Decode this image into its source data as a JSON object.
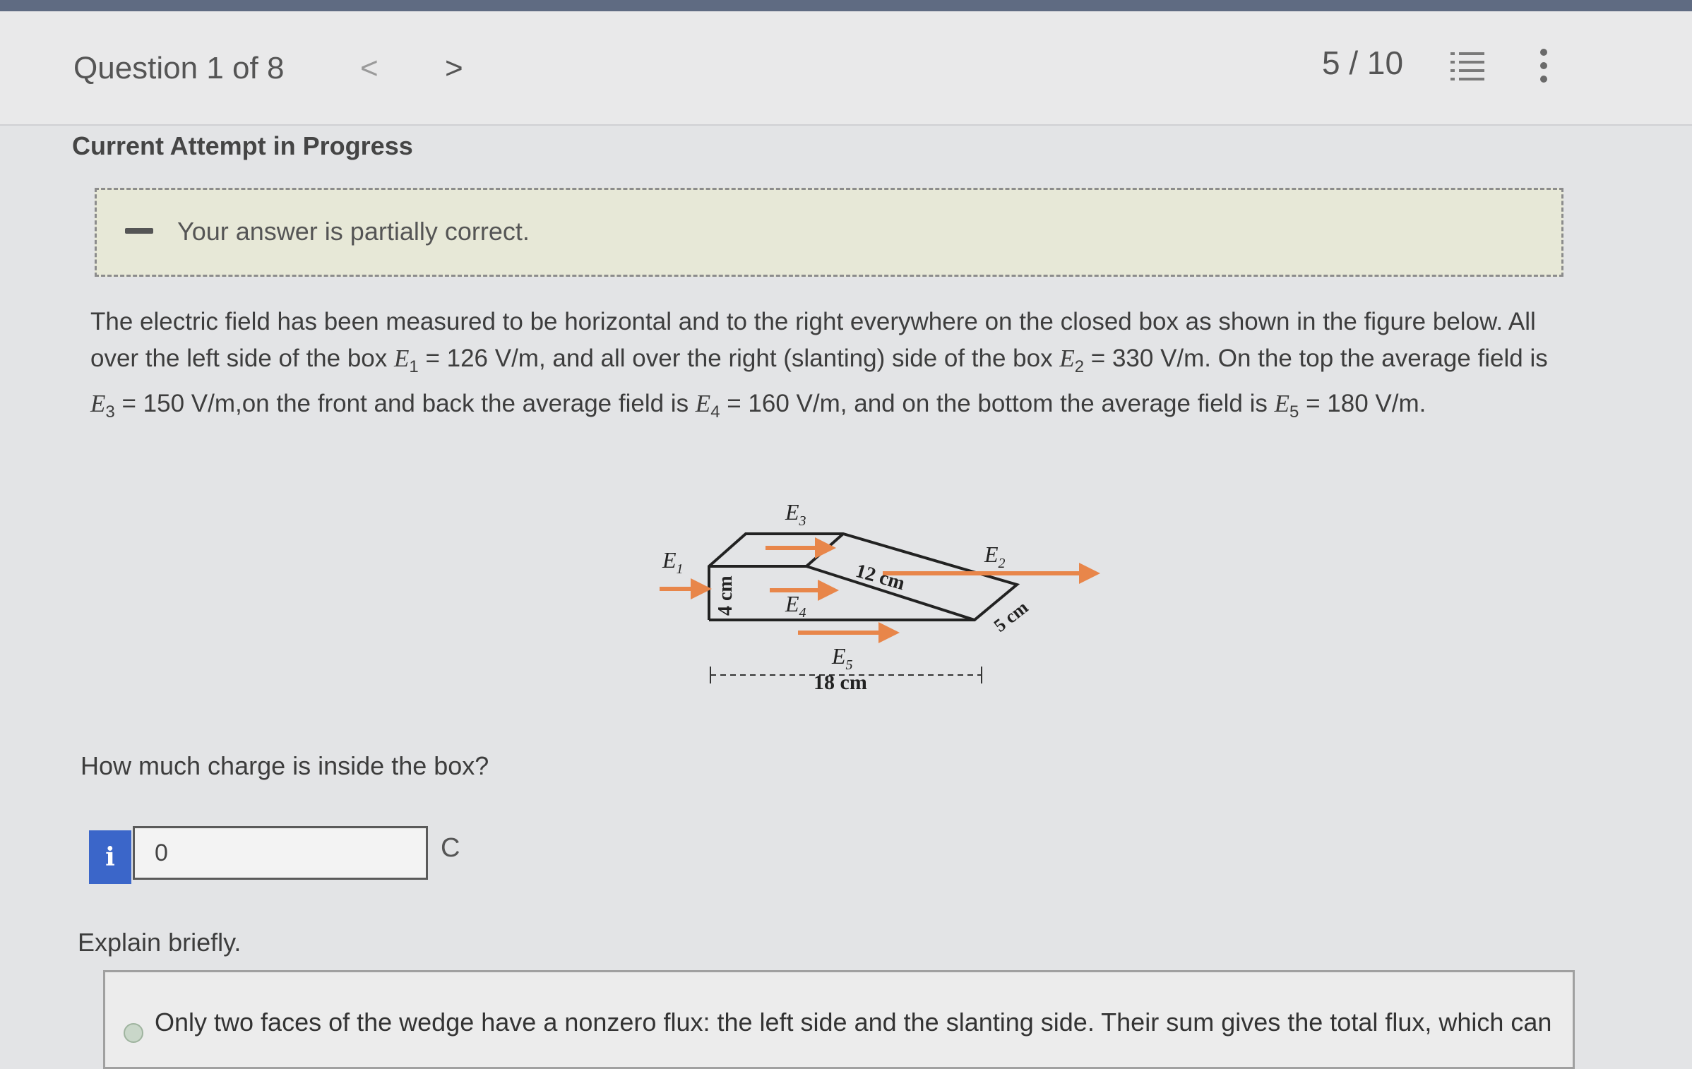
{
  "header": {
    "question_label": "Question 1 of 8",
    "prev": "<",
    "next": ">",
    "score": "5 / 10",
    "list_icon": "list-icon",
    "more_icon": "more-vertical-icon"
  },
  "status": {
    "attempt": "Current Attempt in Progress",
    "feedback": "Your answer is partially correct."
  },
  "problem": {
    "p1": "The electric field has been measured to be horizontal and to the right everywhere on the closed box as shown in the figure below. All over the left side of the box ",
    "e1_sym": "E",
    "e1_sub": "1",
    "e1_val": " = 126 V/m, and all over the right (slanting) side of the box ",
    "e2_sym": "E",
    "e2_sub": "2",
    "e2_val": " = 330 V/m. On the top the average field is ",
    "e3_sym": "E",
    "e3_sub": "3",
    "e3_val": " = 150 V/m,on the front and back the average field is ",
    "e4_sym": "E",
    "e4_sub": "4",
    "e4_val": " = 160 V/m, and on the bottom the average field is ",
    "e5_sym": "E",
    "e5_sub": "5",
    "e5_val": " = 180 V/m."
  },
  "figure": {
    "e1": "E",
    "e1_sub": "1",
    "e2": "E",
    "e2_sub": "2",
    "e3": "E",
    "e3_sub": "3",
    "e4": "E",
    "e4_sub": "4",
    "e5": "E",
    "e5_sub": "5",
    "dim_height": "4 cm",
    "dim_slant": "12 cm",
    "dim_depth": "5 cm",
    "dim_base": "18 cm",
    "arrow_color": "#e8864a"
  },
  "question": {
    "text": "How much charge is inside the box?",
    "info_label": "i",
    "answer_value": "0",
    "unit": "C"
  },
  "explain": {
    "label": "Explain briefly.",
    "text": "Only two faces of the wedge have a nonzero flux: the left side and the slanting side. Their sum gives the total flux, which can"
  }
}
